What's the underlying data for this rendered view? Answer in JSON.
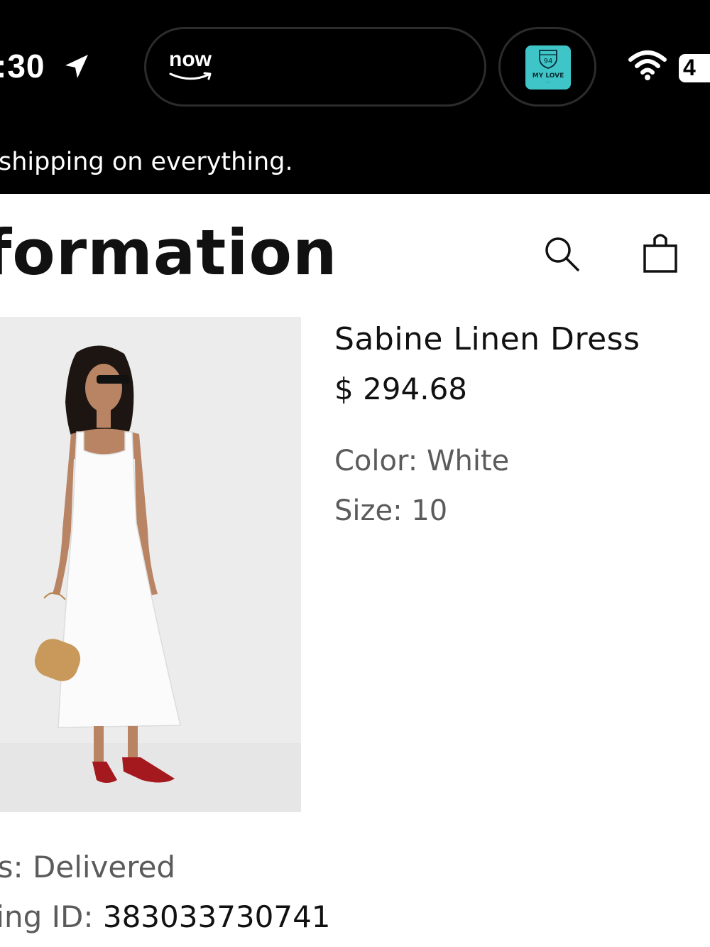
{
  "status_bar": {
    "time": ":30",
    "live_activity_app": "now",
    "now_playing": {
      "album_title": "MY LOVE",
      "shield_number": "94"
    },
    "battery": "4"
  },
  "promo": {
    "text": "shipping on everything."
  },
  "header": {
    "title": "formation"
  },
  "product": {
    "name": "Sabine Linen Dress",
    "price": "$ 294.68",
    "color_label": "Color:",
    "color_value": "White",
    "size_label": "Size:",
    "size_value": "10"
  },
  "order": {
    "status_label": "us:",
    "status_value": "Delivered",
    "tracking_label": "king ID:",
    "tracking_value": "383033730741"
  },
  "colors": {
    "background": "#ffffff",
    "bar": "#000000",
    "text_primary": "#111111",
    "text_secondary": "#5b5b5b",
    "album_accent": "#3fc5c7"
  },
  "icons": [
    "location-arrow-icon",
    "amazon-smile-icon",
    "wifi-icon",
    "battery-icon",
    "search-icon",
    "shopping-bag-icon"
  ]
}
